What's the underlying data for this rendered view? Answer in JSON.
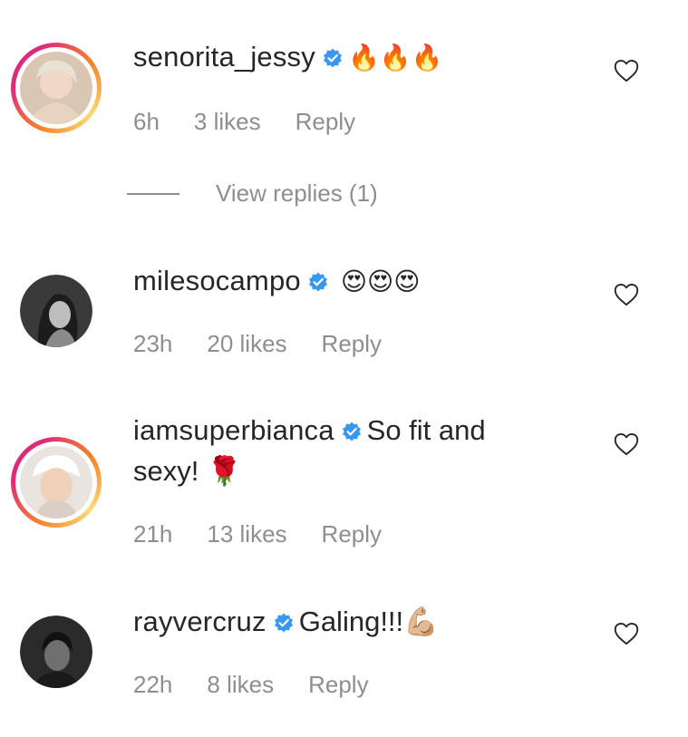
{
  "comments": [
    {
      "username": "senorita_jessy",
      "text": "🔥🔥🔥",
      "time": "6h",
      "likes": "3 likes",
      "reply": "Reply",
      "view_replies": "View replies (1)"
    },
    {
      "username": "milesocampo",
      "text": "😍😍😍",
      "time": "23h",
      "likes": "20 likes",
      "reply": "Reply"
    },
    {
      "username": "iamsuperbianca",
      "text": "So fit and",
      "text2": "sexy! 🌹",
      "time": "21h",
      "likes": "13 likes",
      "reply": "Reply"
    },
    {
      "username": "rayvercruz",
      "text": "Galing!!!💪🏼",
      "time": "22h",
      "likes": "8 likes",
      "reply": "Reply"
    }
  ],
  "colors": {
    "verified": "#3897f0",
    "meta_text": "#8e8e8e",
    "text": "#262626",
    "story_ring_start": "#f58529",
    "story_ring_end": "#dd2a7b"
  },
  "icons": {
    "verified": "verified-badge-icon",
    "like": "heart-outline-icon"
  }
}
